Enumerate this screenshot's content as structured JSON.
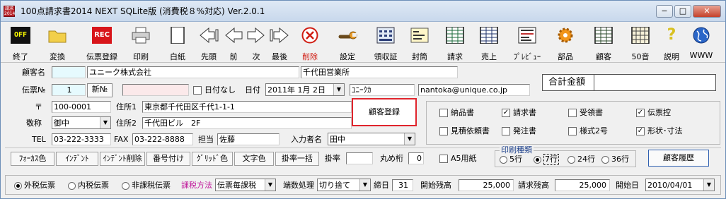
{
  "window": {
    "title": "100点請求書2014 NEXT SQLite版 (消費税８%対応) Ver.2.0.1",
    "app_icon": "請求\n2014",
    "minimize": "−",
    "maximize": "□",
    "close": "✕"
  },
  "toolbar": [
    {
      "label": "終了",
      "icon": "off-icon",
      "icon_text": "OFF"
    },
    {
      "label": "変換",
      "icon": "folder-icon"
    },
    {
      "label": "伝票登録",
      "icon": "rec-icon",
      "icon_text": "REC"
    },
    {
      "label": "印刷",
      "icon": "printer-icon"
    },
    {
      "label": "白紙",
      "icon": "blank-page-icon"
    },
    {
      "label": "先頭",
      "icon": "first-arrow-icon",
      "icon_text": "◁|"
    },
    {
      "label": "前",
      "icon": "prev-arrow-icon",
      "icon_text": "◁"
    },
    {
      "label": "次",
      "icon": "next-arrow-icon",
      "icon_text": "▷"
    },
    {
      "label": "最後",
      "icon": "last-arrow-icon",
      "icon_text": "|▷"
    },
    {
      "label": "削除",
      "icon": "delete-x-icon",
      "icon_text": "✕"
    },
    {
      "label": "設定",
      "icon": "wrench-icon"
    },
    {
      "label": "領収証",
      "icon": "receipt-icon"
    },
    {
      "label": "封筒",
      "icon": "envelope-icon"
    },
    {
      "label": "請求",
      "icon": "invoice-grid-icon"
    },
    {
      "label": "売上",
      "icon": "sales-grid-icon"
    },
    {
      "label": "ﾌﾟﾚﾋﾞｭｰ",
      "icon": "preview-icon"
    },
    {
      "label": "部品",
      "icon": "gear-icon"
    },
    {
      "label": "顧客",
      "icon": "customer-grid-icon"
    },
    {
      "label": "50音",
      "icon": "kana-grid-icon"
    },
    {
      "label": "説明",
      "icon": "help-icon",
      "icon_text": "?"
    },
    {
      "label": "WWW",
      "icon": "globe-icon"
    }
  ],
  "form": {
    "customer_label": "顧客名",
    "customer_code": "",
    "customer_name": "ユニーク株式会社",
    "branch": "千代田営業所",
    "slip_no_label": "伝票№",
    "slip_no": "1",
    "new_no_label": "新№",
    "slip_extra": "",
    "no_date_label": "日付なし",
    "date_label": "日付",
    "date": "2011年 1月 2日",
    "kana": "ﾕﾆｰｸｶ",
    "email": "nantoka@unique.co.jp",
    "total_label": "合計金額",
    "total_value": "",
    "zip_label": "〒",
    "zip": "100-0001",
    "addr1_label": "住所1",
    "addr1": "東京都千代田区千代1-1-1",
    "honorific_label": "敬称",
    "honorific": "御中",
    "addr2_label": "住所2",
    "addr2": "千代田ビル　2F",
    "tel_label": "TEL",
    "tel": "03-222-3333",
    "fax_label": "FAX",
    "fax": "03-222-8888",
    "person_label": "担当",
    "person": "佐藤",
    "entry_label": "入力者名",
    "entry": "田中",
    "register_button": "顧客登録"
  },
  "doc_checks": [
    {
      "label": "納品書",
      "checked": false
    },
    {
      "label": "請求書",
      "checked": true
    },
    {
      "label": "受領書",
      "checked": false
    },
    {
      "label": "伝票控",
      "checked": true
    },
    {
      "label": "見積依頼書",
      "checked": false
    },
    {
      "label": "発注書",
      "checked": false
    },
    {
      "label": "様式2号",
      "checked": false
    },
    {
      "label": "形状･寸法",
      "checked": true
    }
  ],
  "edit_tools": {
    "buttons": [
      "ﾌｫｰｶｽ色",
      "ｲﾝﾃﾞﾝﾄ",
      "ｲﾝﾃﾞﾝﾄ削除",
      "番号付け",
      "ｸﾞﾘｯﾄﾞ色",
      "文字色",
      "掛率一括"
    ],
    "rate_label": "掛率",
    "rate": "",
    "round_label": "丸め桁",
    "round": "0",
    "a5_label": "A5用紙",
    "print_type_label": "印刷種類",
    "print_types": [
      "5行",
      "7行",
      "24行",
      "36行"
    ],
    "print_selected": 1,
    "history_button": "顧客履歴"
  },
  "tax": {
    "options": [
      "外税伝票",
      "内税伝票",
      "非課税伝票"
    ],
    "selected": 0,
    "method_label": "課税方法",
    "method": "伝票毎課税",
    "rounding_label": "端数処理",
    "rounding": "切り捨て",
    "cutoff_label": "締日",
    "cutoff": "31",
    "opening_label": "開始残高",
    "opening": "25,000",
    "billing_label": "請求残高",
    "billing": "25,000",
    "start_label": "開始日",
    "start": "2010/04/01"
  }
}
